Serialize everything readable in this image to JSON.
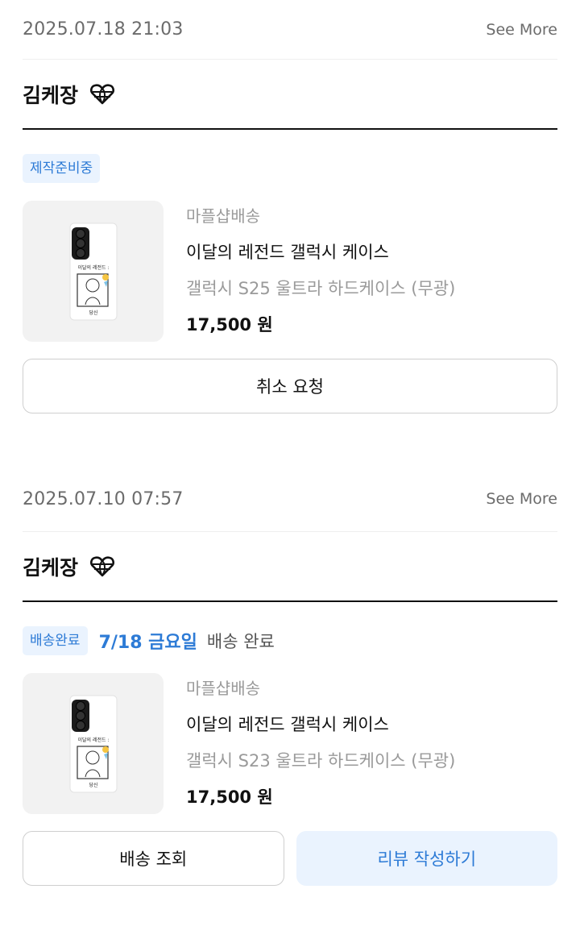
{
  "orders": [
    {
      "date": "2025.07.18 21:03",
      "see_more": "See More",
      "shop_name": "김케장",
      "status_badge": "제작준비중",
      "delivery_date": "",
      "delivery_status": "",
      "delivery_type": "마플샵배송",
      "product_name": "이달의 레전드 갤럭시 케이스",
      "option": "갤럭시 S25 울트라 하드케이스 (무광)",
      "price": "17,500 원",
      "thumb_caption": "이달의 레전드 :",
      "thumb_sub": "당신",
      "buttons": [
        "취소 요청"
      ]
    },
    {
      "date": "2025.07.10 07:57",
      "see_more": "See More",
      "shop_name": "김케장",
      "status_badge": "배송완료",
      "delivery_date": "7/18 금요일",
      "delivery_status": "배송 완료",
      "delivery_type": "마플샵배송",
      "product_name": "이달의 레전드 갤럭시 케이스",
      "option": "갤럭시 S23 울트라 하드케이스 (무광)",
      "price": "17,500 원",
      "thumb_caption": "이달의 레전드 :",
      "thumb_sub": "당신",
      "buttons": [
        "배송 조회",
        "리뷰 작성하기"
      ]
    }
  ],
  "colors": {
    "accent": "#2d7bd6",
    "badge_bg": "#eaf3fe",
    "muted": "#9a9a9a"
  },
  "icons": {
    "shop": "globe-heart-icon"
  }
}
